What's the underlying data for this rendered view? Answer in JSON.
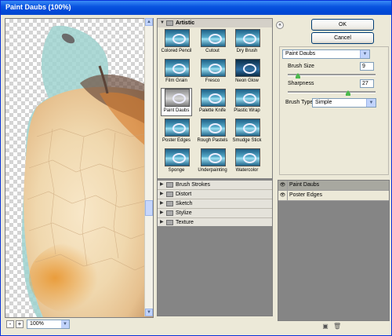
{
  "window": {
    "title": "Paint Daubs (100%)"
  },
  "preview": {
    "zoom_value": "100%",
    "minus_label": "-",
    "plus_label": "+"
  },
  "gallery": {
    "expanded_category": "Artistic",
    "thumbnails": [
      "Colored Pencil",
      "Cutout",
      "Dry Brush",
      "Film Grain",
      "Fresco",
      "Neon Glow",
      "Paint Daubs",
      "Palette Knife",
      "Plastic Wrap",
      "Poster Edges",
      "Rough Pastels",
      "Smudge Stick",
      "Sponge",
      "Underpainting",
      "Watercolor"
    ],
    "selected_thumbnail": "Paint Daubs",
    "collapsed_categories": [
      "Brush Strokes",
      "Distort",
      "Sketch",
      "Stylize",
      "Texture"
    ]
  },
  "buttons": {
    "ok": "OK",
    "cancel": "Cancel"
  },
  "settings": {
    "filter_select": "Paint Daubs",
    "brush_size_label": "Brush Size",
    "brush_size_value": "9",
    "sharpness_label": "Sharpness",
    "sharpness_value": "27",
    "brush_type_label": "Brush Type:",
    "brush_type_value": "Simple"
  },
  "layers": {
    "items": [
      "Paint Daubs",
      "Poster Edges"
    ],
    "selected": "Paint Daubs"
  },
  "icons": {
    "new_layer": "new-effect-layer-icon",
    "delete_layer": "trash-icon"
  }
}
